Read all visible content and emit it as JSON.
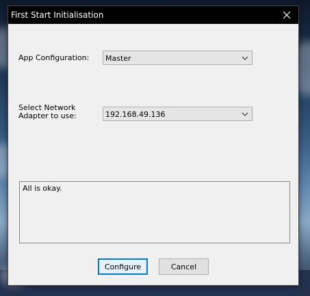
{
  "window": {
    "title": "First Start Initialisation",
    "close_icon": "close-icon"
  },
  "form": {
    "app_config_label": "App Configuration:",
    "app_config_value": "Master",
    "network_label_line1": "Select Network",
    "network_label_line2": "Adapter to use:",
    "network_value": "192.168.49.136"
  },
  "status": {
    "message": "All is okay."
  },
  "buttons": {
    "configure": "Configure",
    "cancel": "Cancel"
  },
  "colors": {
    "accent": "#0078d7",
    "titlebar": "#000000",
    "dialog_bg": "#f0f0f0"
  }
}
